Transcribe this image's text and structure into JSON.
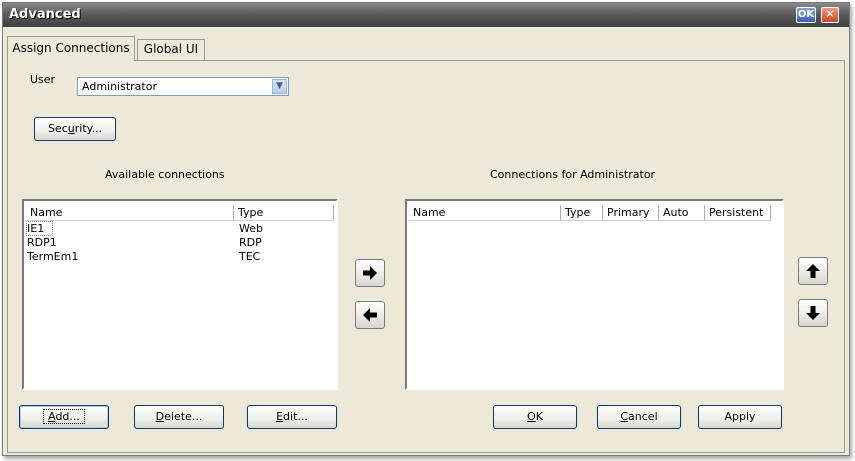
{
  "window": {
    "title": "Advanced",
    "ok_label": "OK",
    "close_glyph": "✕"
  },
  "tabs": [
    {
      "label": "Assign Connections",
      "active": true
    },
    {
      "label": "Global UI",
      "active": false
    }
  ],
  "user": {
    "label": "User",
    "selected": "Administrator",
    "dropdown_icon": "chevron-down-icon"
  },
  "security_button": {
    "pre": "Sec",
    "mnemonic": "u",
    "post": "rity..."
  },
  "available": {
    "title": "Available connections",
    "columns": [
      "Name",
      "Type"
    ],
    "rows": [
      {
        "name": "IE1",
        "type": "Web"
      },
      {
        "name": "RDP1",
        "type": "RDP"
      },
      {
        "name": "TermEm1",
        "type": "TEC"
      }
    ]
  },
  "assigned": {
    "title": "Connections for Administrator",
    "columns": [
      "Name",
      "Type",
      "Primary",
      "Auto",
      "Persistent"
    ],
    "rows": []
  },
  "move_icons": [
    "arrow-right-icon",
    "arrow-left-icon",
    "arrow-up-icon",
    "arrow-down-icon"
  ],
  "buttons": {
    "add": {
      "mnemonic": "A",
      "rest": "dd..."
    },
    "delete": {
      "mnemonic": "D",
      "rest": "elete..."
    },
    "edit": {
      "mnemonic": "E",
      "rest": "dit..."
    },
    "ok": {
      "mnemonic": "O",
      "rest": "K"
    },
    "cancel": {
      "mnemonic": "C",
      "rest": "ancel"
    },
    "apply": {
      "label": "Apply"
    }
  }
}
